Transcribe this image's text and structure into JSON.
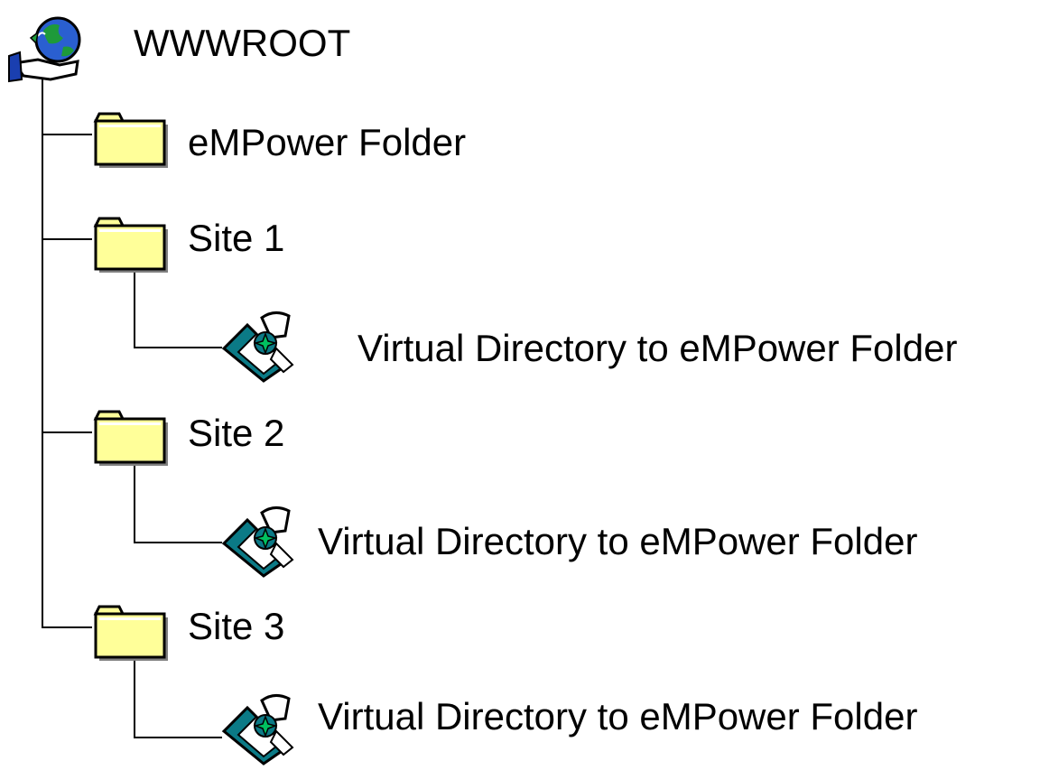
{
  "tree": {
    "root": {
      "label": "WWWROOT",
      "icon": "web-server-globe-icon"
    },
    "items": [
      {
        "label": "eMPower Folder",
        "icon": "folder-icon"
      },
      {
        "label": "Site 1",
        "icon": "folder-icon",
        "child": {
          "label": "Virtual Directory to eMPower Folder",
          "icon": "virtual-directory-icon"
        }
      },
      {
        "label": "Site 2",
        "icon": "folder-icon",
        "child": {
          "label": "Virtual Directory to eMPower Folder",
          "icon": "virtual-directory-icon"
        }
      },
      {
        "label": "Site 3",
        "icon": "folder-icon",
        "child": {
          "label": "Virtual Directory to eMPower Folder",
          "icon": "virtual-directory-icon"
        }
      }
    ]
  },
  "colors": {
    "folder_fill": "#ffff99",
    "folder_shadow": "#808080",
    "connector": "#000000",
    "globe_blue": "#2a5fd0",
    "globe_green": "#1e9a3a",
    "vdir_teal": "#0b7a86",
    "vdir_green": "#00c060"
  }
}
